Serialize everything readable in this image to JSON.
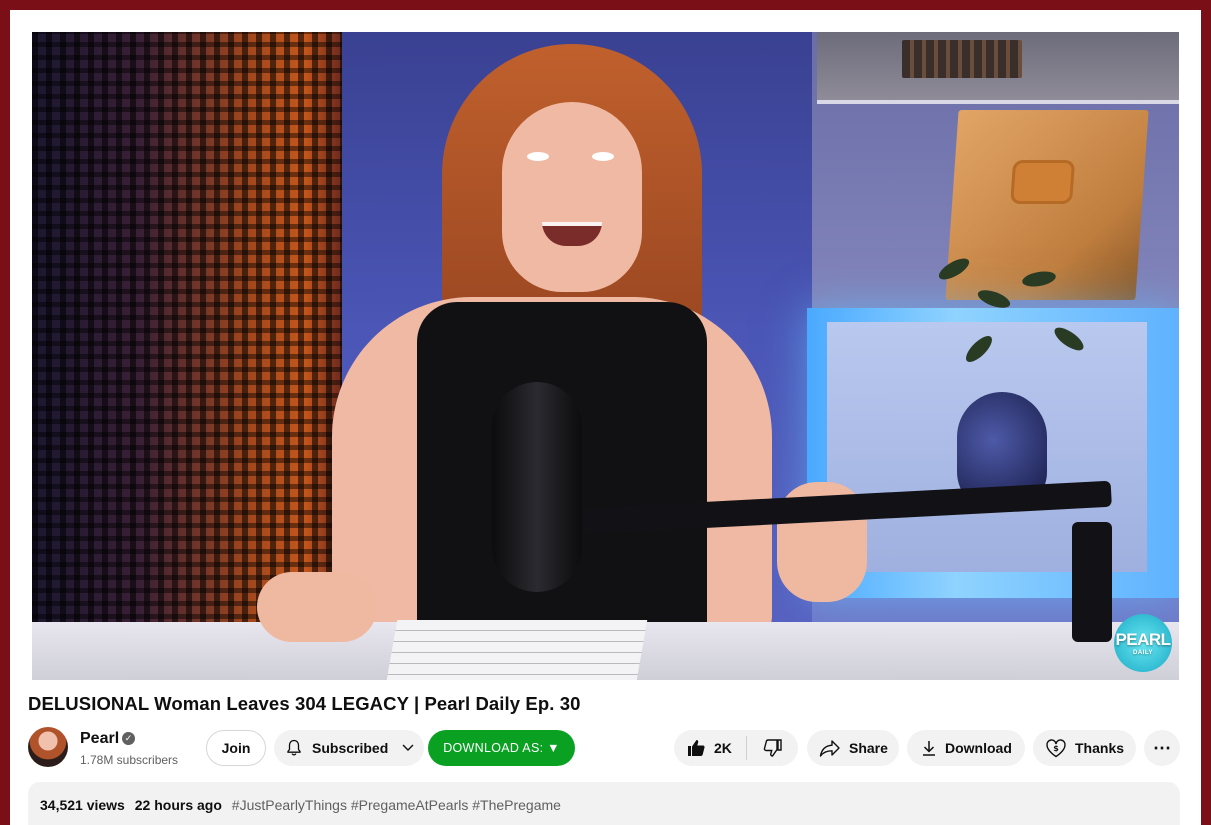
{
  "video": {
    "title": "DELUSIONAL Woman Leaves 304 LEGACY | Pearl Daily Ep. 30",
    "watermark": "PEARL",
    "watermark_sub": "DAILY"
  },
  "channel": {
    "name": "Pearl",
    "subscribers": "1.78M subscribers"
  },
  "actions": {
    "join": "Join",
    "subscribed": "Subscribed",
    "download_as": "DOWNLOAD AS: ▼",
    "likes": "2K",
    "share": "Share",
    "download": "Download",
    "thanks": "Thanks",
    "more": "⋯"
  },
  "description": {
    "views": "34,521 views",
    "age": "22 hours ago",
    "hashtags": "#JustPearlyThings #PregameAtPearls #ThePregame"
  },
  "colors": {
    "border": "#7a0f17",
    "download_as": "#0aa022"
  }
}
